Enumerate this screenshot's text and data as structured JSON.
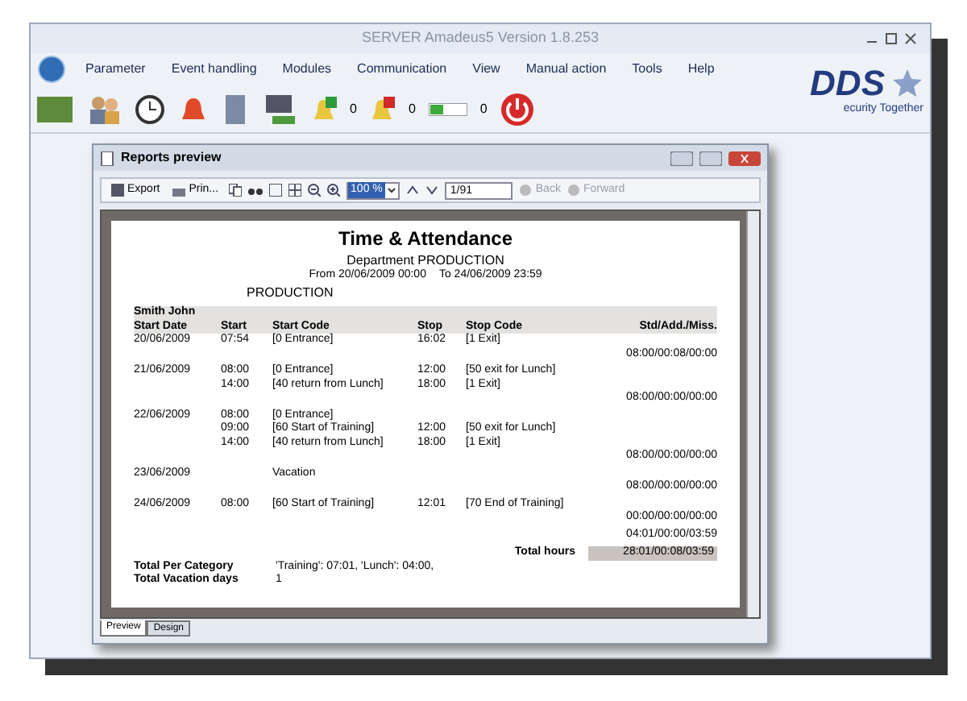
{
  "app": {
    "title": "SERVER Amadeus5 Version 1.8.253",
    "menu": [
      "Parameter",
      "Event handling",
      "Modules",
      "Communication",
      "View",
      "Manual action",
      "Tools",
      "Help"
    ],
    "toolbar_counters": [
      "0",
      "0",
      "0"
    ],
    "logo": "DDS",
    "tagline": "ecurity Together"
  },
  "preview": {
    "title": "Reports preview",
    "toolbar": {
      "export": "Export",
      "print": "Prin...",
      "zoom": "100 %",
      "page": "1/91",
      "back": {
        "label": "Back",
        "disabled": true
      },
      "forward": {
        "label": "Forward",
        "disabled": true
      }
    },
    "report": {
      "title": "Time & Attendance",
      "department": "Department PRODUCTION",
      "from": "From 20/06/2009 00:00",
      "to": "To 24/06/2009 23:59",
      "section": "PRODUCTION",
      "employee": "Smith John",
      "columns": [
        "Start Date",
        "Start",
        "Start Code",
        "Stop",
        "Stop Code",
        "Std/Add./Miss."
      ],
      "rows": [
        {
          "kind": "entry",
          "date": "20/06/2009",
          "start": "07:54",
          "start_code": "[0 Entrance]",
          "stop": "16:02",
          "stop_code": "[1 Exit]"
        },
        {
          "kind": "subtotal",
          "value": "08:00/00:08/00:00"
        },
        {
          "kind": "entry",
          "date": "21/06/2009",
          "start": "08:00",
          "start_code": "[0 Entrance]",
          "stop": "12:00",
          "stop_code": "[50 exit for Lunch]"
        },
        {
          "kind": "entry",
          "start": "14:00",
          "start_code": "[40 return from Lunch]",
          "stop": "18:00",
          "stop_code": "[1 Exit]"
        },
        {
          "kind": "subtotal",
          "value": "08:00/00:00/00:00"
        },
        {
          "kind": "entry",
          "date": "22/06/2009",
          "start": "08:00",
          "start_code": "[0 Entrance]"
        },
        {
          "kind": "entry",
          "start": "09:00",
          "start_code": "[60 Start of Training]",
          "stop": "12:00",
          "stop_code": "[50 exit for Lunch]"
        },
        {
          "kind": "entry",
          "start": "14:00",
          "start_code": "[40 return from Lunch]",
          "stop": "18:00",
          "stop_code": "[1 Exit]"
        },
        {
          "kind": "subtotal",
          "value": "08:00/00:00/00:00"
        },
        {
          "kind": "entry",
          "date": "23/06/2009",
          "start_code": "Vacation"
        },
        {
          "kind": "subtotal",
          "value": "08:00/00:00/00:00"
        },
        {
          "kind": "entry",
          "date": "24/06/2009",
          "start": "08:00",
          "start_code": "[60 Start of Training]",
          "stop": "12:01",
          "stop_code": "[70 End of Training]"
        },
        {
          "kind": "subtotal",
          "value": "00:00/00:00/00:00"
        },
        {
          "kind": "subtotal",
          "value": "04:01/00:00/03:59"
        }
      ],
      "total_label": "Total hours",
      "total_value": "28:01/00:08/03:59",
      "per_category_label": "Total Per Category",
      "per_category_value": "'Training': 07:01, 'Lunch': 04:00,",
      "vacation_label": "Total Vacation days",
      "vacation_value": "1"
    },
    "tabs": [
      {
        "label": "Preview",
        "selected": true
      },
      {
        "label": "Design",
        "selected": false
      }
    ]
  }
}
